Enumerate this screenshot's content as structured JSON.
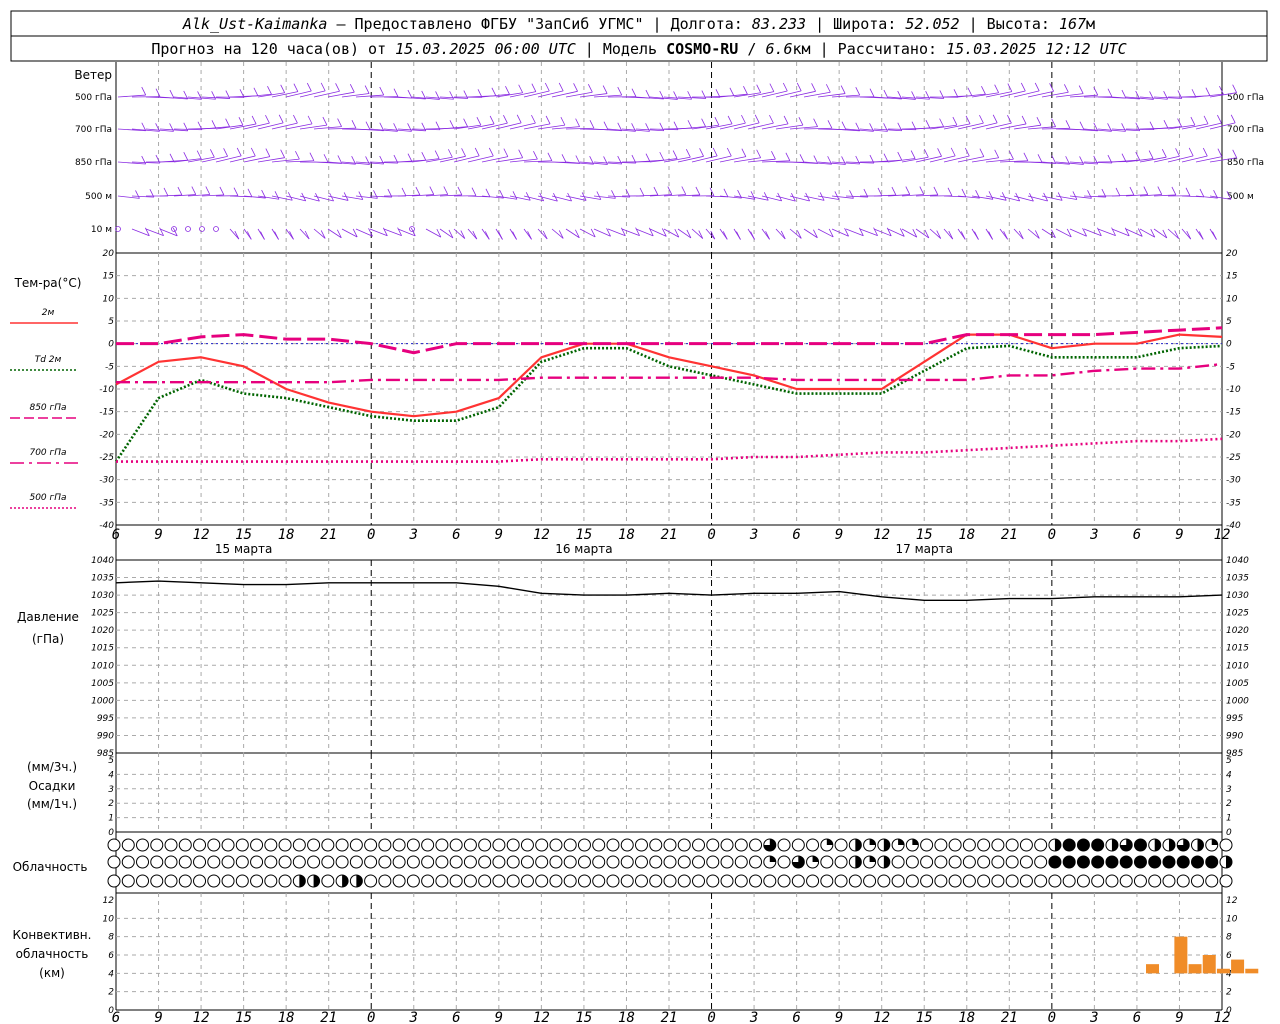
{
  "header": {
    "line1": {
      "station": "Alk_Ust-Kaimanka",
      "provider": " – Предоставлено ФГБУ \"ЗапСиб УГМС\" | ",
      "lon_label": "Долгота: ",
      "lon": "83.233",
      "lat_label": " | Широта: ",
      "lat": "52.052",
      "alt_label": " | Высота: ",
      "alt": "167",
      "alt_unit": "м"
    },
    "line2": {
      "prefix": "Прогноз на 120 часа(ов) от ",
      "run": "15.03.2025 06:00 UTC",
      "model_label": "  | Модель ",
      "model": "COSMO-RU",
      "res_sep": " / ",
      "res": "6.6",
      "res_unit": "км",
      "calc_label": " | Рассчитано: ",
      "calc": "15.03.2025 12:12 UTC"
    }
  },
  "wind_panel": {
    "title": "Ветер",
    "levels": [
      "500 гПа",
      "700 гПа",
      "850 гПа",
      "500 м",
      "10  м"
    ],
    "color": "#8a2be2"
  },
  "temp_panel": {
    "title": "Тем-ра(°C)",
    "legend": [
      {
        "label": "2м",
        "color": "#ff3333",
        "style": "solid"
      },
      {
        "label": "Td  2м",
        "color": "#006400",
        "style": "dotted"
      },
      {
        "label": "850 гПа",
        "color": "#e6007e",
        "style": "dashed"
      },
      {
        "label": "700 гПа",
        "color": "#e6007e",
        "style": "dashdot"
      },
      {
        "label": "500 гПа",
        "color": "#e6007e",
        "style": "dotted"
      }
    ]
  },
  "pressure_panel": {
    "title": "Давление",
    "unit": "(гПа)"
  },
  "precip_panel": {
    "unit3": "(мм/3ч.)",
    "title": "Осадки",
    "unit1": "(мм/1ч.)"
  },
  "cloud_panel": {
    "title": "Облачность"
  },
  "conv_panel": {
    "title1": "Конвективн.",
    "title2": "облачность",
    "unit": "(км)"
  },
  "x_axis": {
    "tick_labels": [
      "6",
      "9",
      "12",
      "15",
      "18",
      "21",
      "0",
      "3",
      "6",
      "9",
      "12",
      "15",
      "18",
      "21",
      "0",
      "3",
      "6",
      "9",
      "12",
      "15",
      "18",
      "21",
      "0",
      "3",
      "6",
      "9",
      "12"
    ],
    "date_labels": [
      "15 марта",
      "16 марта",
      "17 марта"
    ]
  },
  "chart_data": [
    {
      "type": "line",
      "title": "Тем-ра(°C)",
      "x_hours": [
        0,
        3,
        6,
        9,
        12,
        15,
        18,
        21,
        24,
        27,
        30,
        33,
        36,
        39,
        42,
        45,
        48,
        51,
        54,
        57,
        60,
        63,
        66,
        69,
        72,
        75,
        78
      ],
      "ylim": [
        -40,
        20
      ],
      "yticks": [
        20,
        15,
        10,
        5,
        0,
        -5,
        -10,
        -15,
        -20,
        -25,
        -30,
        -35,
        -40
      ],
      "series": [
        {
          "name": "2м",
          "values": [
            -9,
            -4,
            -3,
            -5,
            -10,
            -13,
            -15,
            -16,
            -15,
            -12,
            -3,
            0,
            0,
            -3,
            -5,
            -7,
            -10,
            -10,
            -10,
            -4,
            2,
            2,
            -1,
            0,
            0,
            2,
            1.5
          ]
        },
        {
          "name": "Td  2м",
          "values": [
            -26,
            -12,
            -8,
            -11,
            -12,
            -14,
            -16,
            -17,
            -17,
            -14,
            -4,
            -1,
            -1,
            -5,
            -7,
            -9,
            -11,
            -11,
            -11,
            -6,
            -1,
            -0.5,
            -3,
            -3,
            -3,
            -1,
            -0.5
          ]
        },
        {
          "name": "850 гПа",
          "values": [
            0,
            0,
            1.5,
            2,
            1,
            1,
            0,
            -2,
            0,
            0,
            0,
            0,
            0,
            0,
            0,
            0,
            0,
            0,
            0,
            0,
            2,
            2,
            2,
            2,
            2.5,
            3,
            3.5
          ]
        },
        {
          "name": "700 гПа",
          "values": [
            -8.5,
            -8.5,
            -8.5,
            -8.5,
            -8.5,
            -8.5,
            -8,
            -8,
            -8,
            -8,
            -7.5,
            -7.5,
            -7.5,
            -7.5,
            -7.5,
            -7.5,
            -8,
            -8,
            -8,
            -8,
            -8,
            -7,
            -7,
            -6,
            -5.5,
            -5.5,
            -4.5
          ]
        },
        {
          "name": "500 гПа",
          "values": [
            -26,
            -26,
            -26,
            -26,
            -26,
            -26,
            -26,
            -26,
            -26,
            -26,
            -25.5,
            -25.5,
            -25.5,
            -25.5,
            -25.5,
            -25,
            -25,
            -24.5,
            -24,
            -24,
            -23.5,
            -23,
            -22.5,
            -22,
            -21.5,
            -21.5,
            -21
          ]
        }
      ]
    },
    {
      "type": "line",
      "title": "Давление",
      "x_hours": [
        0,
        3,
        6,
        9,
        12,
        15,
        18,
        21,
        24,
        27,
        30,
        33,
        36,
        39,
        42,
        45,
        48,
        51,
        54,
        57,
        60,
        63,
        66,
        69,
        72,
        75,
        78
      ],
      "ylim": [
        985,
        1040
      ],
      "yticks": [
        1040,
        1035,
        1030,
        1025,
        1020,
        1015,
        1010,
        1005,
        1000,
        995,
        990,
        985
      ],
      "series": [
        {
          "name": "",
          "values": [
            1033.5,
            1034,
            1033.5,
            1033,
            1033,
            1033.5,
            1033.5,
            1033.5,
            1033.5,
            1032.5,
            1030.5,
            1030,
            1030,
            1030.5,
            1030,
            1030.5,
            1030.5,
            1031,
            1029.5,
            1028.5,
            1028.5,
            1029,
            1029,
            1029.5,
            1029.5,
            1029.5,
            1030
          ]
        }
      ]
    },
    {
      "type": "bar",
      "title": "Осадки",
      "ylim": [
        0,
        5
      ],
      "yticks": [
        5,
        4,
        3,
        2,
        1,
        0
      ],
      "series": []
    },
    {
      "type": "bar",
      "title": "Конвективн. облачность",
      "ylim": [
        0,
        12
      ],
      "yticks": [
        12,
        10,
        8,
        6,
        4,
        2,
        0
      ],
      "bars": [
        {
          "x_hour": 72.5,
          "bottom": 4,
          "top": 5
        },
        {
          "x_hour": 74.5,
          "bottom": 4,
          "top": 8
        },
        {
          "x_hour": 75.5,
          "bottom": 4,
          "top": 5
        },
        {
          "x_hour": 76.5,
          "bottom": 4,
          "top": 6
        },
        {
          "x_hour": 77.5,
          "bottom": 4,
          "top": 4.5
        },
        {
          "x_hour": 78.5,
          "bottom": 4,
          "top": 5.5
        },
        {
          "x_hour": 79.5,
          "bottom": 4,
          "top": 4.5
        }
      ]
    }
  ],
  "cloud_rows": {
    "count_per_row": 79,
    "upper": {
      "fills": {
        "46": 0.75,
        "50": 0.25,
        "52": 0.5,
        "53": 0.25,
        "54": 0.5,
        "55": 0.25,
        "56": 0.25,
        "66": 0.5,
        "67": 1,
        "68": 1,
        "69": 1,
        "70": 0.5,
        "71": 0.75,
        "72": 1,
        "73": 0.5,
        "74": 0.5,
        "75": 0.75,
        "76": 0.5,
        "77": 0.25
      }
    },
    "middle": {
      "fills": {
        "46": 0.25,
        "48": 0.75,
        "49": 0.25,
        "52": 0.5,
        "53": 0.25,
        "54": 0.5,
        "66": 1,
        "67": 1,
        "68": 1,
        "69": 1,
        "70": 1,
        "71": 1,
        "72": 1,
        "73": 1,
        "74": 1,
        "75": 1,
        "76": 1,
        "77": 1,
        "78": 0.5
      }
    },
    "lower": {
      "fills": {
        "13": 0.5,
        "14": 0.5,
        "16": 0.5,
        "17": 0.5
      }
    }
  }
}
